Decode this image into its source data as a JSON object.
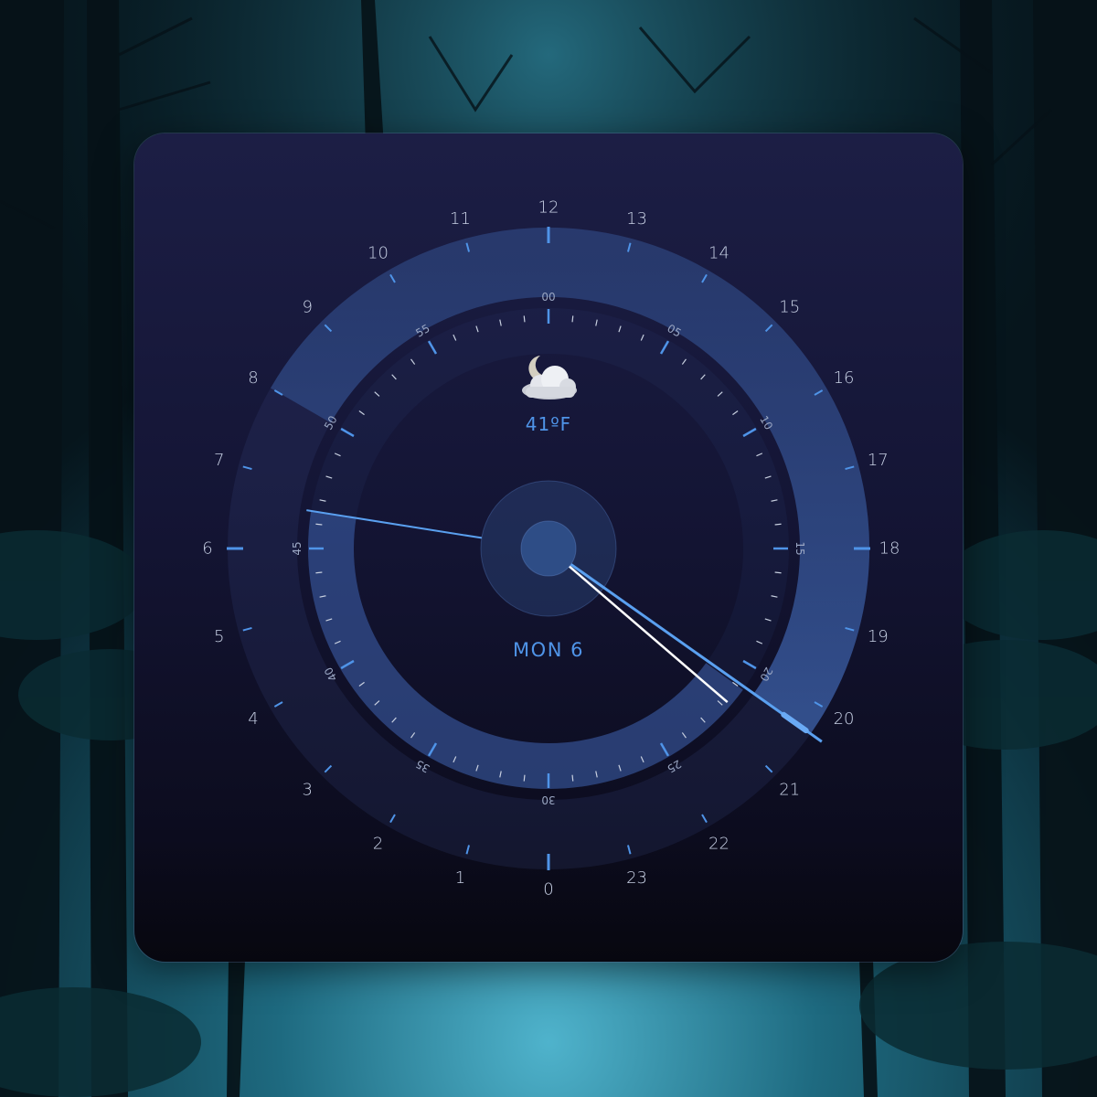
{
  "weather": {
    "icon": "cloudy-night-icon",
    "temperature": "41ºF"
  },
  "date": {
    "label": "MON 6"
  },
  "time": {
    "hour": 20,
    "minute": 21,
    "second": 46.5
  },
  "dial": {
    "hour_labels": [
      "0",
      "1",
      "2",
      "3",
      "4",
      "5",
      "6",
      "7",
      "8",
      "9",
      "10",
      "11",
      "12",
      "13",
      "14",
      "15",
      "16",
      "17",
      "18",
      "19",
      "20",
      "21",
      "22",
      "23"
    ],
    "minute_labels": [
      "00",
      "05",
      "10",
      "15",
      "20",
      "25",
      "30",
      "35",
      "40",
      "45",
      "50",
      "55"
    ]
  },
  "colors": {
    "accent": "#4f94e8",
    "hand_white": "#ffffff",
    "hand_blue": "#5aa0f0",
    "widget_bg_top": "#1c1e45",
    "widget_bg_bottom": "#07070f"
  }
}
